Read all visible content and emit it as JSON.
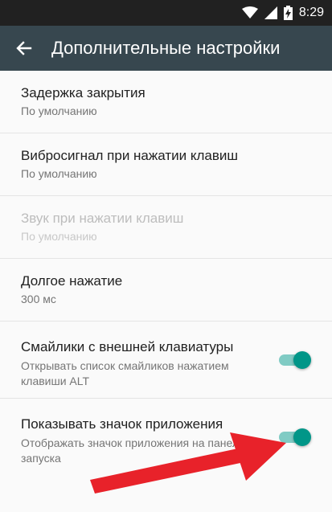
{
  "status_bar": {
    "time": "8:29",
    "battery_glyph": "⚡"
  },
  "toolbar": {
    "title": "Дополнительные настройки"
  },
  "settings": {
    "items": [
      {
        "title": "Задержка закрытия",
        "subtitle": "По умолчанию",
        "enabled": true
      },
      {
        "title": "Вибросигнал при нажатии клавиш",
        "subtitle": "По умолчанию",
        "enabled": true
      },
      {
        "title": "Звук при нажатии клавиш",
        "subtitle": "По умолчанию",
        "enabled": false
      },
      {
        "title": "Долгое нажатие",
        "subtitle": "300 мс",
        "enabled": true
      },
      {
        "title": "Смайлики с внешней клавиатуры",
        "subtitle": "Открывать список смайликов нажатием клавиши ALT",
        "toggle": true
      },
      {
        "title": "Показывать значок приложения",
        "subtitle": "Отображать значок приложения на панели запуска",
        "toggle": true
      }
    ]
  },
  "colors": {
    "toolbar": "#37474f",
    "status_bar": "#212121",
    "accent": "#009688",
    "annotation_arrow": "#e8222a"
  },
  "icons": {
    "back": "arrow-left-icon",
    "wifi": "wifi-icon",
    "signal": "cell-signal-icon",
    "battery": "battery-charging-icon"
  }
}
